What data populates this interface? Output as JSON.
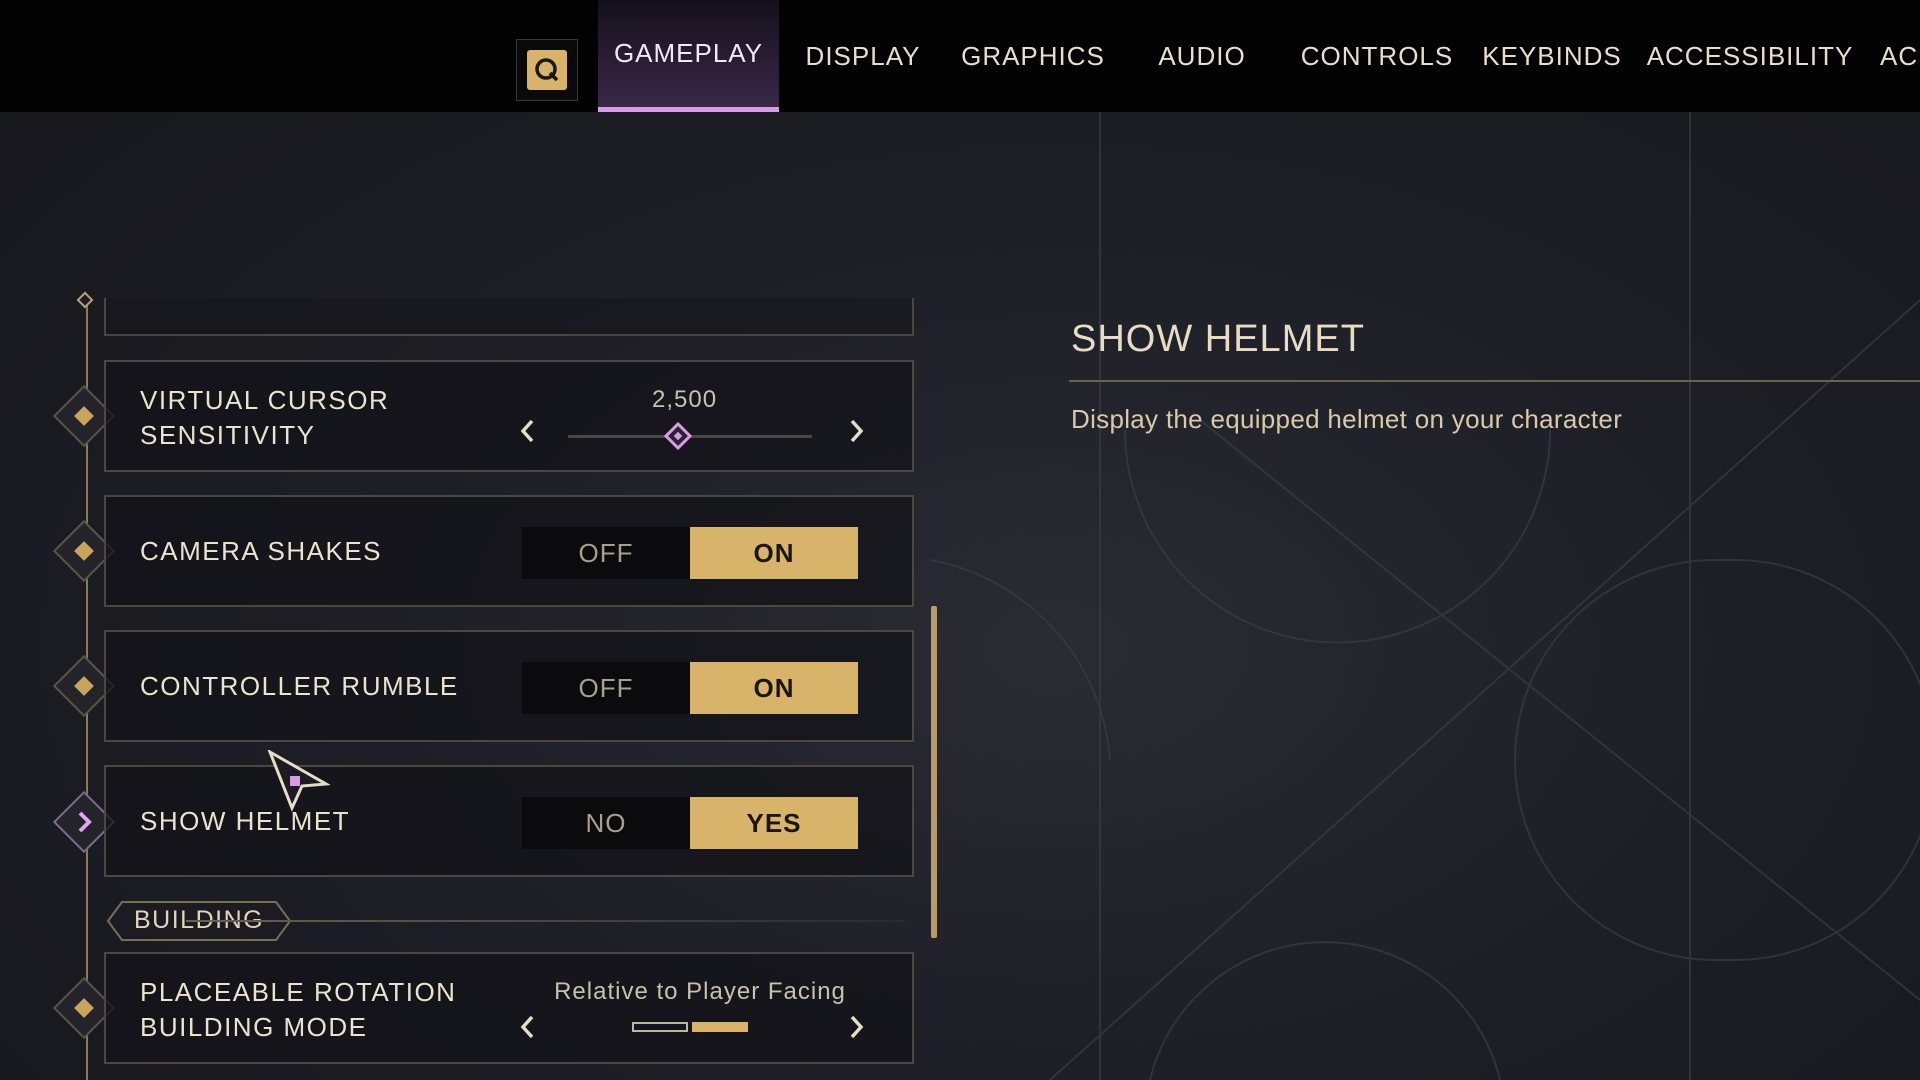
{
  "nav": {
    "tabs": [
      {
        "label": "GAMEPLAY",
        "active": true
      },
      {
        "label": "DISPLAY"
      },
      {
        "label": "GRAPHICS"
      },
      {
        "label": "AUDIO"
      },
      {
        "label": "CONTROLS"
      },
      {
        "label": "KEYBINDS"
      },
      {
        "label": "ACCESSIBILITY"
      },
      {
        "label": "AC"
      }
    ],
    "search_key": "Q"
  },
  "settings": {
    "virtual_cursor": {
      "label_line1": "VIRTUAL CURSOR",
      "label_line2": "SENSITIVITY",
      "value": "2,500",
      "level": 0.45
    },
    "camera_shakes": {
      "label": "CAMERA SHAKES",
      "off": "OFF",
      "on": "ON",
      "selected": "ON"
    },
    "controller_rumble": {
      "label": "CONTROLLER RUMBLE",
      "off": "OFF",
      "on": "ON",
      "selected": "ON"
    },
    "show_helmet": {
      "label": "SHOW HELMET",
      "off": "NO",
      "on": "YES",
      "selected": "YES"
    },
    "section_building": "BUILDING",
    "placeable_rotation": {
      "label_line1": "PLACEABLE ROTATION",
      "label_line2": "BUILDING MODE",
      "value": "Relative to Player Facing",
      "selected_index": 2,
      "option_count": 2
    }
  },
  "description": {
    "title": "SHOW HELMET",
    "text": "Display the equipped helmet on your character"
  },
  "colors": {
    "accent_gold": "#d8b46a",
    "accent_purple": "#d69ce6",
    "background": "#1e1f26"
  }
}
